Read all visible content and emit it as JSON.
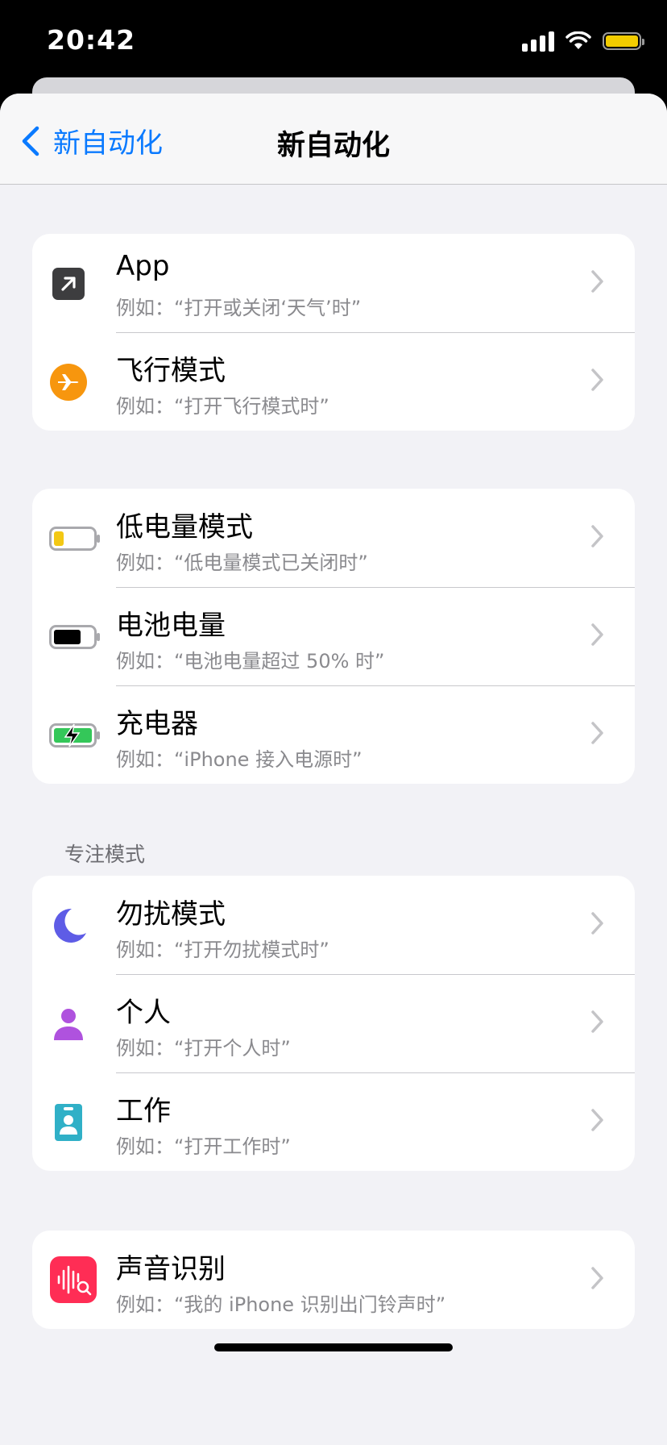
{
  "status_bar": {
    "time": "20:42",
    "battery_color": "#f2cc00"
  },
  "nav": {
    "back_label": "新自动化",
    "title": "新自动化",
    "accent_color": "#0a7aff"
  },
  "groups": [
    {
      "header": "",
      "rows": [
        {
          "icon": "app-arrow-icon",
          "title": "App",
          "subtitle": "例如：“打开或关闭‘天气’时”"
        },
        {
          "icon": "airplane-icon",
          "title": "飞行模式",
          "subtitle": "例如：“打开飞行模式时”"
        }
      ]
    },
    {
      "header": "",
      "rows": [
        {
          "icon": "low-battery-icon",
          "title": "低电量模式",
          "subtitle": "例如：“低电量模式已关闭时”"
        },
        {
          "icon": "battery-level-icon",
          "title": "电池电量",
          "subtitle": "例如：“电池电量超过 50% 时”"
        },
        {
          "icon": "charger-icon",
          "title": "充电器",
          "subtitle": "例如：“iPhone 接入电源时”"
        }
      ]
    },
    {
      "header": "专注模式",
      "rows": [
        {
          "icon": "moon-icon",
          "title": "勿扰模式",
          "subtitle": "例如：“打开勿扰模式时”"
        },
        {
          "icon": "person-icon",
          "title": "个人",
          "subtitle": "例如：“打开个人时”"
        },
        {
          "icon": "work-badge-icon",
          "title": "工作",
          "subtitle": "例如：“打开工作时”"
        }
      ]
    },
    {
      "header": "",
      "rows": [
        {
          "icon": "sound-recognition-icon",
          "title": "声音识别",
          "subtitle": "例如：“我的 iPhone 识别出门铃声时”"
        }
      ]
    }
  ]
}
